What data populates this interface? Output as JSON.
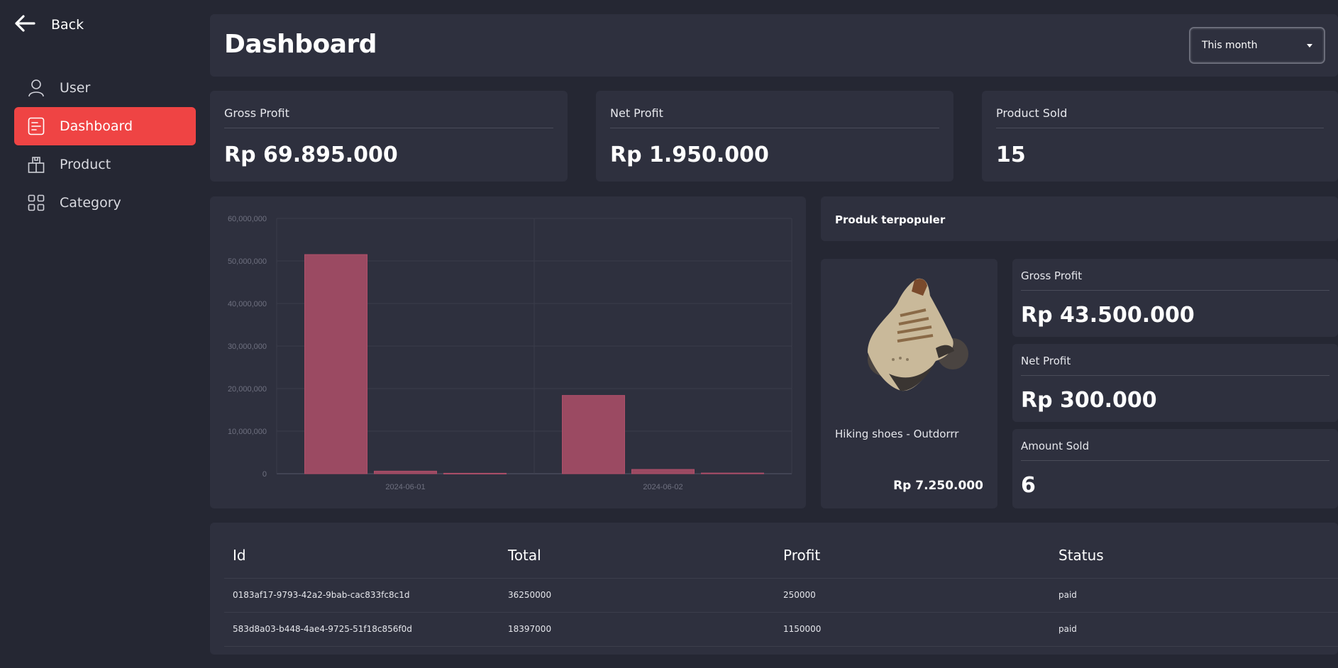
{
  "nav": {
    "back_label": "Back",
    "items": [
      {
        "label": "User",
        "icon": "user-icon",
        "active": false
      },
      {
        "label": "Dashboard",
        "icon": "dashboard-icon",
        "active": true
      },
      {
        "label": "Product",
        "icon": "product-icon",
        "active": false
      },
      {
        "label": "Category",
        "icon": "category-icon",
        "active": false
      }
    ]
  },
  "header": {
    "title": "Dashboard",
    "period_select": "This month"
  },
  "stats": [
    {
      "label": "Gross Profit",
      "value": "Rp 69.895.000"
    },
    {
      "label": "Net Profit",
      "value": "Rp 1.950.000"
    },
    {
      "label": "Product Sold",
      "value": "15"
    }
  ],
  "chart_data": {
    "type": "bar",
    "categories": [
      "2024-06-01",
      "2024-06-02"
    ],
    "series": [
      {
        "values": [
          51500000,
          18397000
        ]
      },
      {
        "values": [
          600000,
          1000000
        ]
      },
      {
        "values": [
          100000,
          150000
        ]
      }
    ],
    "ylim": [
      0,
      60000000
    ],
    "yticks": [
      "0",
      "10,000,000",
      "20,000,000",
      "30,000,000",
      "40,000,000",
      "50,000,000",
      "60,000,000"
    ],
    "grid": true,
    "colors": {
      "bar": "#9b4a62"
    }
  },
  "popular": {
    "title": "Produk terpopuler",
    "product_name": "Hiking shoes - Outdorrr",
    "product_price": "Rp 7.250.000",
    "stats": [
      {
        "label": "Gross Profit",
        "value": "Rp 43.500.000"
      },
      {
        "label": "Net Profit",
        "value": "Rp 300.000"
      },
      {
        "label": "Amount Sold",
        "value": "6"
      }
    ]
  },
  "table": {
    "headers": [
      "Id",
      "Total",
      "Profit",
      "Status"
    ],
    "rows": [
      [
        "0183af17-9793-42a2-9bab-cac833fc8c1d",
        "36250000",
        "250000",
        "paid"
      ],
      [
        "583d8a03-b448-4ae4-9725-51f18c856f0d",
        "18397000",
        "1150000",
        "paid"
      ]
    ]
  },
  "colors": {
    "accent": "#ef4444",
    "background": "#252733",
    "panel": "#2e303e"
  }
}
